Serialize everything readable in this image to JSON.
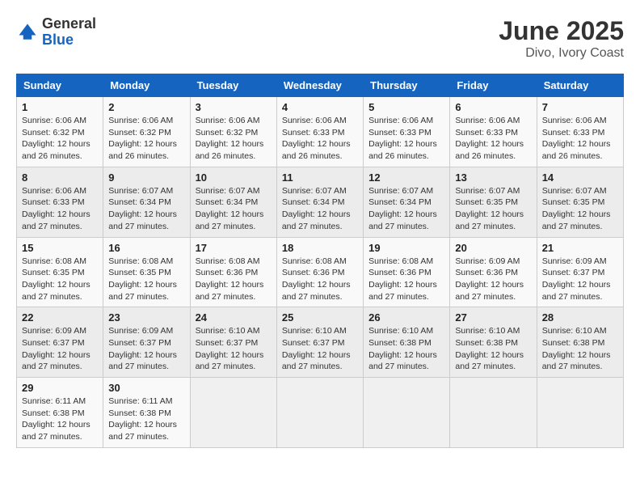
{
  "header": {
    "logo_general": "General",
    "logo_blue": "Blue",
    "main_title": "June 2025",
    "subtitle": "Divo, Ivory Coast"
  },
  "calendar": {
    "days_of_week": [
      "Sunday",
      "Monday",
      "Tuesday",
      "Wednesday",
      "Thursday",
      "Friday",
      "Saturday"
    ],
    "weeks": [
      [
        {
          "day": "1",
          "sunrise": "6:06 AM",
          "sunset": "6:32 PM",
          "daylight": "12 hours and 26 minutes."
        },
        {
          "day": "2",
          "sunrise": "6:06 AM",
          "sunset": "6:32 PM",
          "daylight": "12 hours and 26 minutes."
        },
        {
          "day": "3",
          "sunrise": "6:06 AM",
          "sunset": "6:32 PM",
          "daylight": "12 hours and 26 minutes."
        },
        {
          "day": "4",
          "sunrise": "6:06 AM",
          "sunset": "6:33 PM",
          "daylight": "12 hours and 26 minutes."
        },
        {
          "day": "5",
          "sunrise": "6:06 AM",
          "sunset": "6:33 PM",
          "daylight": "12 hours and 26 minutes."
        },
        {
          "day": "6",
          "sunrise": "6:06 AM",
          "sunset": "6:33 PM",
          "daylight": "12 hours and 26 minutes."
        },
        {
          "day": "7",
          "sunrise": "6:06 AM",
          "sunset": "6:33 PM",
          "daylight": "12 hours and 26 minutes."
        }
      ],
      [
        {
          "day": "8",
          "sunrise": "6:06 AM",
          "sunset": "6:33 PM",
          "daylight": "12 hours and 27 minutes."
        },
        {
          "day": "9",
          "sunrise": "6:07 AM",
          "sunset": "6:34 PM",
          "daylight": "12 hours and 27 minutes."
        },
        {
          "day": "10",
          "sunrise": "6:07 AM",
          "sunset": "6:34 PM",
          "daylight": "12 hours and 27 minutes."
        },
        {
          "day": "11",
          "sunrise": "6:07 AM",
          "sunset": "6:34 PM",
          "daylight": "12 hours and 27 minutes."
        },
        {
          "day": "12",
          "sunrise": "6:07 AM",
          "sunset": "6:34 PM",
          "daylight": "12 hours and 27 minutes."
        },
        {
          "day": "13",
          "sunrise": "6:07 AM",
          "sunset": "6:35 PM",
          "daylight": "12 hours and 27 minutes."
        },
        {
          "day": "14",
          "sunrise": "6:07 AM",
          "sunset": "6:35 PM",
          "daylight": "12 hours and 27 minutes."
        }
      ],
      [
        {
          "day": "15",
          "sunrise": "6:08 AM",
          "sunset": "6:35 PM",
          "daylight": "12 hours and 27 minutes."
        },
        {
          "day": "16",
          "sunrise": "6:08 AM",
          "sunset": "6:35 PM",
          "daylight": "12 hours and 27 minutes."
        },
        {
          "day": "17",
          "sunrise": "6:08 AM",
          "sunset": "6:36 PM",
          "daylight": "12 hours and 27 minutes."
        },
        {
          "day": "18",
          "sunrise": "6:08 AM",
          "sunset": "6:36 PM",
          "daylight": "12 hours and 27 minutes."
        },
        {
          "day": "19",
          "sunrise": "6:08 AM",
          "sunset": "6:36 PM",
          "daylight": "12 hours and 27 minutes."
        },
        {
          "day": "20",
          "sunrise": "6:09 AM",
          "sunset": "6:36 PM",
          "daylight": "12 hours and 27 minutes."
        },
        {
          "day": "21",
          "sunrise": "6:09 AM",
          "sunset": "6:37 PM",
          "daylight": "12 hours and 27 minutes."
        }
      ],
      [
        {
          "day": "22",
          "sunrise": "6:09 AM",
          "sunset": "6:37 PM",
          "daylight": "12 hours and 27 minutes."
        },
        {
          "day": "23",
          "sunrise": "6:09 AM",
          "sunset": "6:37 PM",
          "daylight": "12 hours and 27 minutes."
        },
        {
          "day": "24",
          "sunrise": "6:10 AM",
          "sunset": "6:37 PM",
          "daylight": "12 hours and 27 minutes."
        },
        {
          "day": "25",
          "sunrise": "6:10 AM",
          "sunset": "6:37 PM",
          "daylight": "12 hours and 27 minutes."
        },
        {
          "day": "26",
          "sunrise": "6:10 AM",
          "sunset": "6:38 PM",
          "daylight": "12 hours and 27 minutes."
        },
        {
          "day": "27",
          "sunrise": "6:10 AM",
          "sunset": "6:38 PM",
          "daylight": "12 hours and 27 minutes."
        },
        {
          "day": "28",
          "sunrise": "6:10 AM",
          "sunset": "6:38 PM",
          "daylight": "12 hours and 27 minutes."
        }
      ],
      [
        {
          "day": "29",
          "sunrise": "6:11 AM",
          "sunset": "6:38 PM",
          "daylight": "12 hours and 27 minutes."
        },
        {
          "day": "30",
          "sunrise": "6:11 AM",
          "sunset": "6:38 PM",
          "daylight": "12 hours and 27 minutes."
        },
        null,
        null,
        null,
        null,
        null
      ]
    ],
    "labels": {
      "sunrise": "Sunrise:",
      "sunset": "Sunset:",
      "daylight": "Daylight:"
    }
  }
}
